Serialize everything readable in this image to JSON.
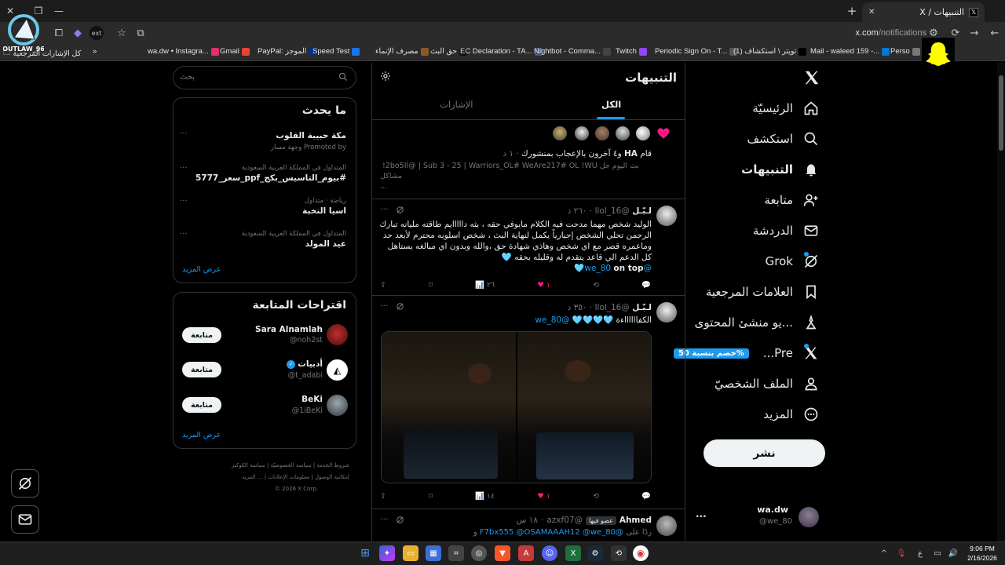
{
  "browser": {
    "tab_title": "التنبيهات / X",
    "url_domain": "x.com",
    "url_path": "/notifications",
    "bookmarks_left": "كل الإشارات المرجعية",
    "bookmarks": [
      {
        "label": "wa.dw • Instagra...",
        "color": "#e1306c"
      },
      {
        "label": "Gmail",
        "color": "#ea4335"
      },
      {
        "label": "PayPal: الموجز",
        "color": "#003087"
      },
      {
        "label": "Speed Test",
        "color": "#1a73e8"
      },
      {
        "label": "مصرف الإنماء",
        "color": "#8b5a2b"
      },
      {
        "label": "حق البث",
        "color": "#111111"
      },
      {
        "label": "EC Declaration - TA...",
        "color": "#3d5a80"
      },
      {
        "label": "Nightbot - Comma...",
        "color": "#444444"
      },
      {
        "label": "Twitch",
        "color": "#9146ff"
      },
      {
        "label": "Periodic Sign On - T...",
        "color": "#555555"
      },
      {
        "label": "(1) تويتر \\ استكشاف",
        "color": "#000000"
      },
      {
        "label": "Mail - waleed 159 -...",
        "color": "#0078d4"
      },
      {
        "label": "Perso",
        "color": "#777777"
      }
    ],
    "logo_text": "OUTLAW_96"
  },
  "sidebar": {
    "items": [
      {
        "label": "الرئيسيّة",
        "icon": "home-icon"
      },
      {
        "label": "استكشف",
        "icon": "search-icon"
      },
      {
        "label": "التنبيهات",
        "icon": "bell-icon"
      },
      {
        "label": "متابعة",
        "icon": "add-user-icon"
      },
      {
        "label": "الدردشة",
        "icon": "mail-icon"
      },
      {
        "label": "Grok",
        "icon": "grok-icon"
      },
      {
        "label": "العلامات المرجعية",
        "icon": "bookmark-icon"
      },
      {
        "label": "...يو منشئ المحتوى",
        "icon": "creator-icon"
      },
      {
        "label": "Pre...",
        "icon": "x-icon"
      },
      {
        "label": "الملف الشخصيّ",
        "icon": "profile-icon"
      },
      {
        "label": "المزيد",
        "icon": "more-icon"
      }
    ],
    "promo_badge": "%خصم بنسبة 50",
    "post_button": "نشر",
    "account": {
      "name": "wa.dw",
      "handle": "@we_80",
      "more": "..."
    }
  },
  "main": {
    "title": "التنبيهات",
    "tabs": [
      {
        "label": "الكل"
      },
      {
        "label": "الإشارات"
      }
    ],
    "like_notification": {
      "summary_bold": "HA",
      "summary_prefix": "قام",
      "summary_rest": "و٤ آخرون بالإعجاب بمنشورك",
      "time": "١ د",
      "text_line1": "بث اليوم حل   2bo5Il@ | Sub 3 - 25 | Warriors_OL#  WeAre217#  OL !WU!",
      "text_line2": "مشاكل",
      "text_line3": "..."
    },
    "tweets": [
      {
        "name": "لـبّـل",
        "handle": "@llol_16",
        "time": "٢٦٠ د",
        "body": "الوليد شخص مهما مدحت فيه الكلام مايوفي حقه ، بثه دااااايم طاقته مليانه تبارك الرحمن تحلي الشخص إجبارياً يكمل لنهاية البث ، شخص اسلوبه محترم لأبعد حد وماعمره قصر مع اي شخص وهاذي شهادة حق ،والله وبدون اي مبالغه يستاهل كل الدعم الي قاعد يتقدم له وقليله بحقه 🩵",
        "mention": "@we_80",
        "mention_suffix": "on top",
        "replies": "",
        "retweets": "",
        "likes": "١",
        "views": "٢٦"
      },
      {
        "name": "لـبّـل",
        "handle": "@llol_16",
        "time": "٣٥٠ د",
        "body": "الكفااااااءة 🩵🩵🩵🩵",
        "mention": "@we_80",
        "likes": "١",
        "views": "١٤"
      },
      {
        "name": "Ahmed",
        "badge": "عضو فيها",
        "handle": "@azxf07",
        "time": "١٨ س",
        "reply_prefix": "ردًا على",
        "reply_to": "@F7bx555 @OSAMAAAH12 @we_80",
        "reply_suffix": "و"
      }
    ]
  },
  "right": {
    "search_placeholder": "بحث",
    "trends_title": "ما يحدث",
    "trends": [
      {
        "meta": "",
        "name": "مكة حبيبة القلوب",
        "promo": "Promoted by وجهة مسار"
      },
      {
        "meta": "المتداول في المملكة العربية السعودية",
        "name": "#بيوم_التاسيس_بكج_ppf_سعر_5777"
      },
      {
        "meta": "رياضة · متداول",
        "name": "اسيا النخبة"
      },
      {
        "meta": "المتداول في المملكة العربية السعودية",
        "name": "عيد المولد"
      }
    ],
    "show_more": "عرض المزيد",
    "follow_title": "اقتراحات المتابعة",
    "suggestions": [
      {
        "name": "Sara Alnamlah",
        "handle": "@noh2st",
        "button": "متابعة",
        "verified": false
      },
      {
        "name": "أدبيات",
        "handle": "@t_adabi",
        "button": "متابعة",
        "verified": true
      },
      {
        "name": "BeKi",
        "handle": "@1iBeKi",
        "button": "متابعة",
        "verified": false
      }
    ],
    "footer": {
      "line1": [
        "شروط الخدمة",
        "سياسة الخصوصيّة",
        "سياسة الكوكيز"
      ],
      "line2": [
        "إمكانية الوصول",
        "معلومات الإعلانات",
        "... المزيد"
      ],
      "copyright": "© 2026 X Corp."
    }
  },
  "taskbar": {
    "time": "9:06 PM",
    "date": "2/16/2026",
    "lang": "ع"
  }
}
